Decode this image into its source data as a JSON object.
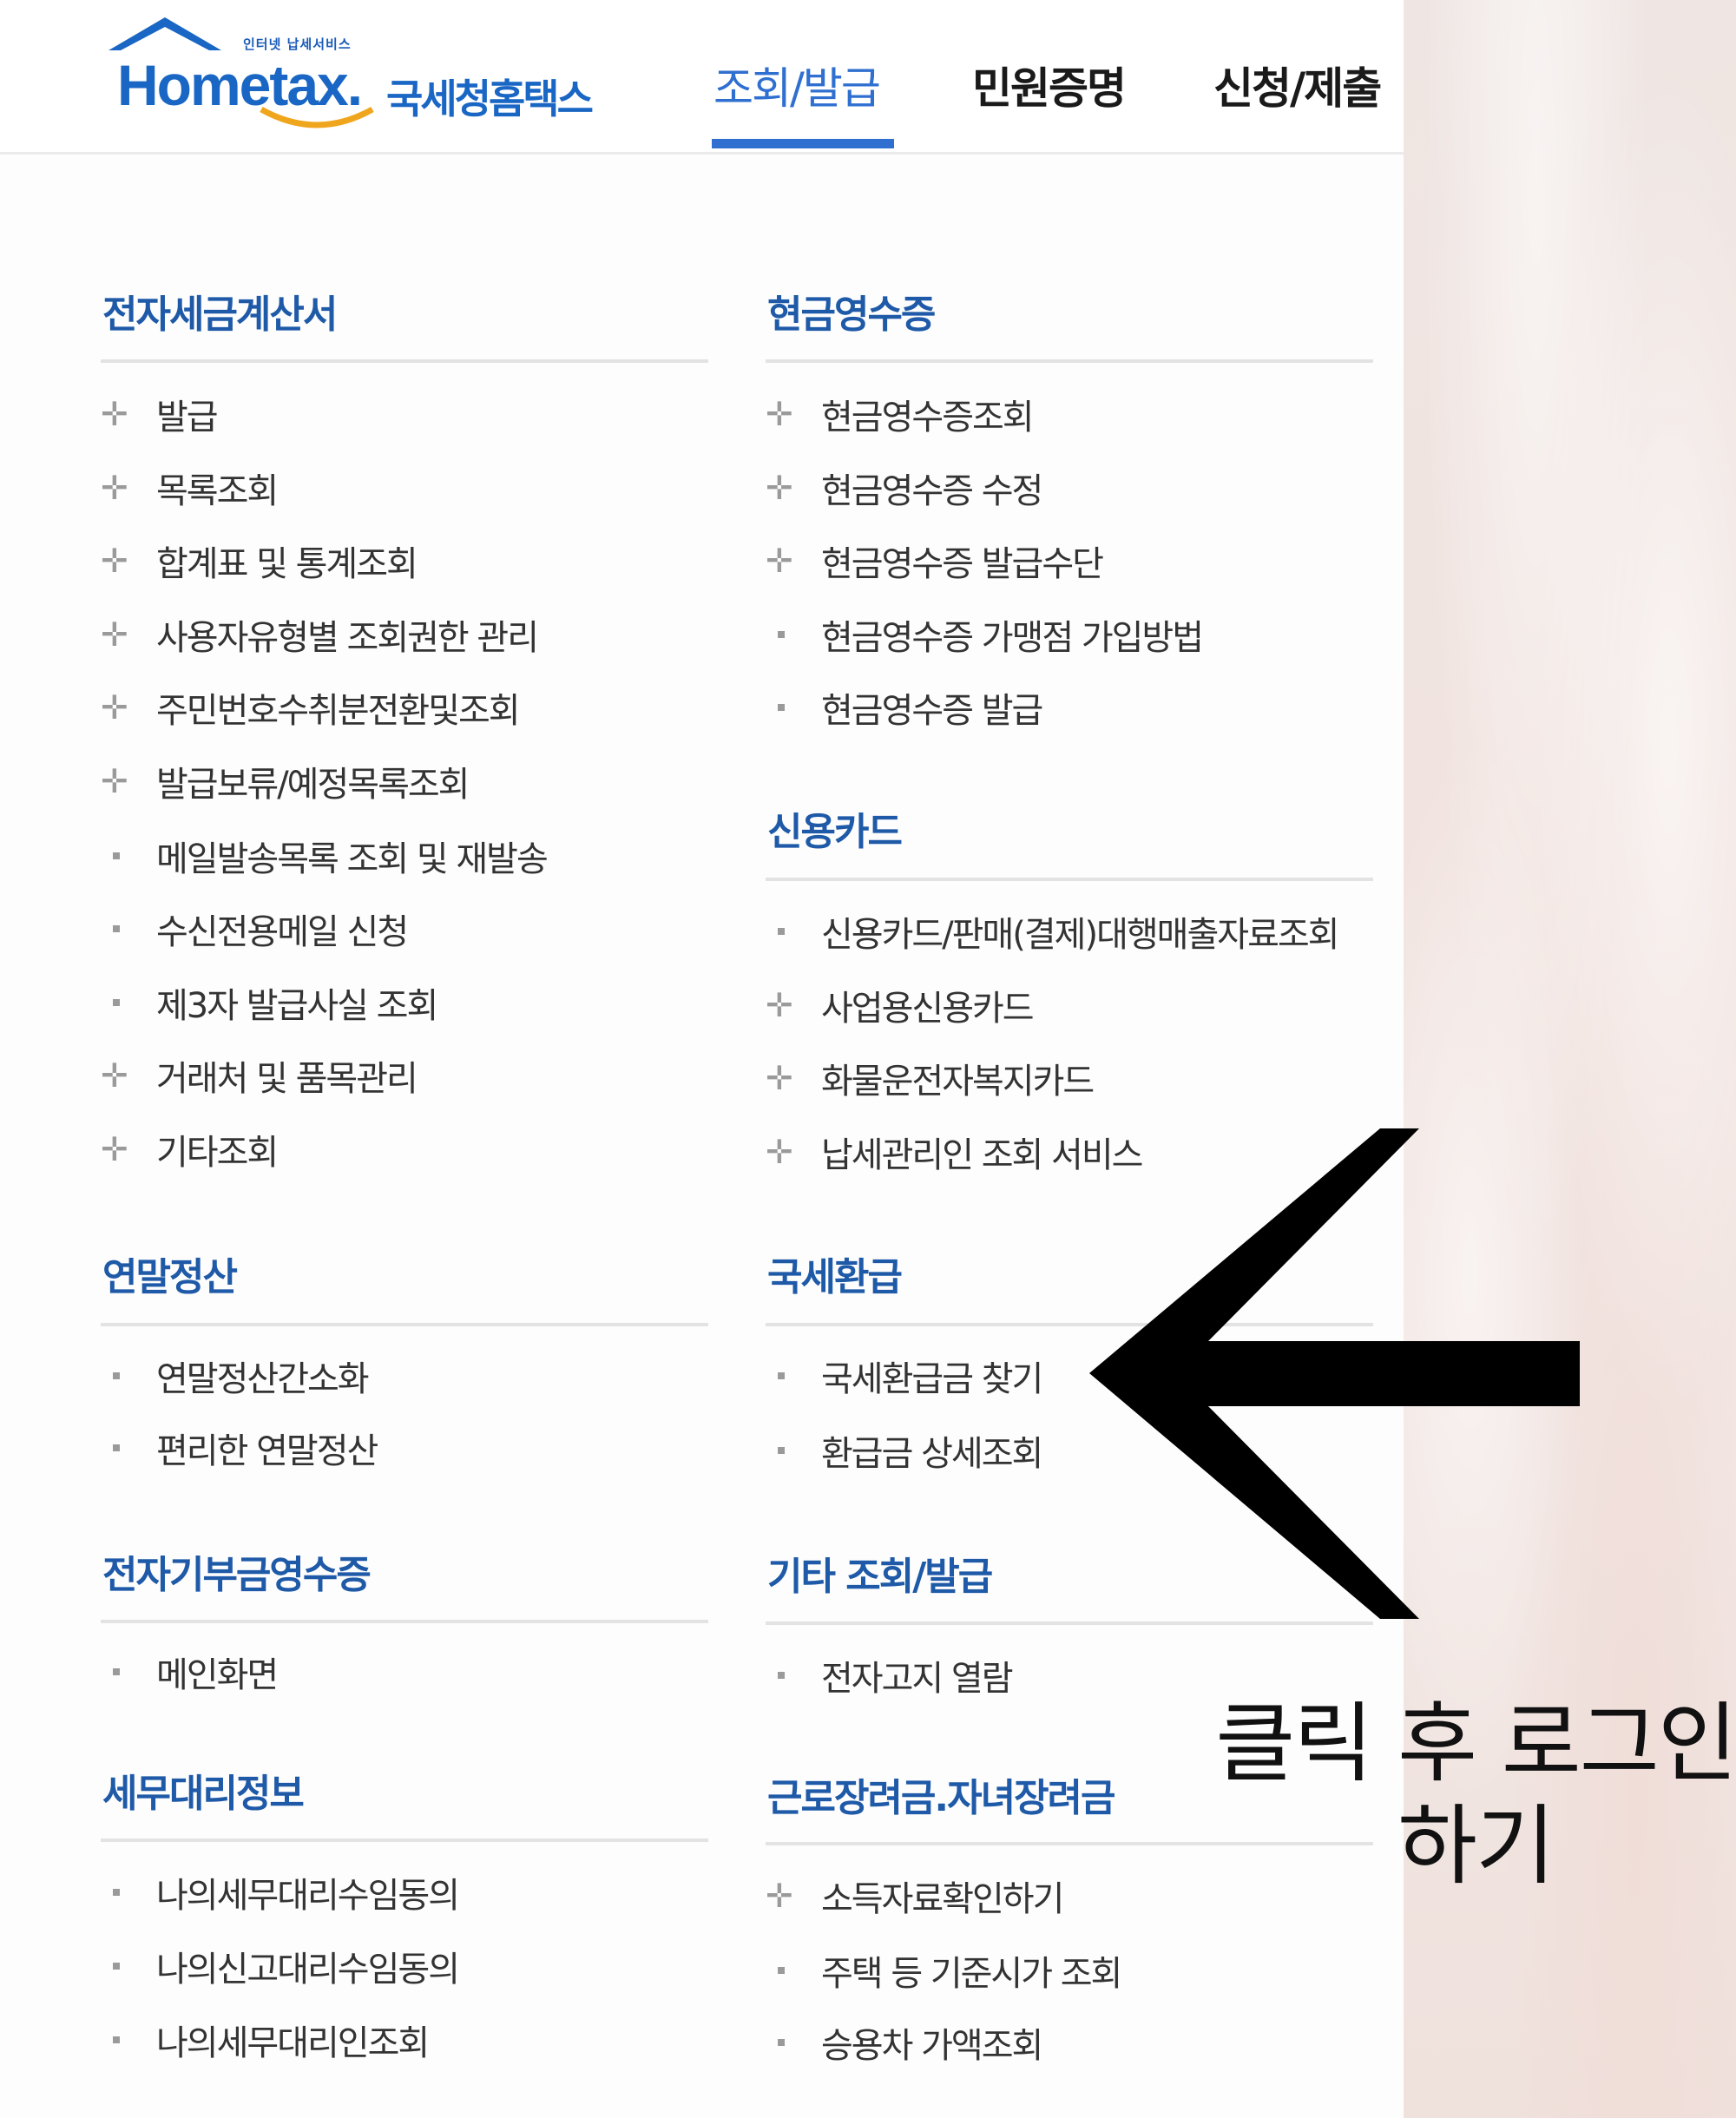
{
  "header": {
    "logo": {
      "small_text": "인터넷 납세서비스",
      "brand_text": "Hometax.",
      "korean_text": "국세청홈택스"
    },
    "tabs": [
      {
        "label": "조회/발급",
        "active": true
      },
      {
        "label": "민원증명",
        "active": false
      },
      {
        "label": "신청/제출",
        "active": false
      }
    ]
  },
  "left_column": [
    {
      "title": "전자세금계산서",
      "items": [
        {
          "label": "발급",
          "marker": "plus"
        },
        {
          "label": "목록조회",
          "marker": "plus"
        },
        {
          "label": "합계표 및 통계조회",
          "marker": "plus"
        },
        {
          "label": "사용자유형별 조회권한 관리",
          "marker": "plus"
        },
        {
          "label": "주민번호수취분전환및조회",
          "marker": "plus"
        },
        {
          "label": "발급보류/예정목록조회",
          "marker": "plus"
        },
        {
          "label": "메일발송목록 조회 및 재발송",
          "marker": "dot"
        },
        {
          "label": "수신전용메일 신청",
          "marker": "dot"
        },
        {
          "label": "제3자 발급사실 조회",
          "marker": "dot"
        },
        {
          "label": "거래처 및 품목관리",
          "marker": "plus"
        },
        {
          "label": "기타조회",
          "marker": "plus"
        }
      ]
    },
    {
      "title": "연말정산",
      "items": [
        {
          "label": "연말정산간소화",
          "marker": "dot"
        },
        {
          "label": "편리한 연말정산",
          "marker": "dot"
        }
      ]
    },
    {
      "title": "전자기부금영수증",
      "items": [
        {
          "label": "메인화면",
          "marker": "dot"
        }
      ]
    },
    {
      "title": "세무대리정보",
      "items": [
        {
          "label": "나의세무대리수임동의",
          "marker": "dot"
        },
        {
          "label": "나의신고대리수임동의",
          "marker": "dot"
        },
        {
          "label": "나의세무대리인조회",
          "marker": "dot"
        }
      ]
    }
  ],
  "right_column": [
    {
      "title": "현금영수증",
      "items": [
        {
          "label": "현금영수증조회",
          "marker": "plus"
        },
        {
          "label": "현금영수증 수정",
          "marker": "plus"
        },
        {
          "label": "현금영수증 발급수단",
          "marker": "plus"
        },
        {
          "label": "현금영수증 가맹점 가입방법",
          "marker": "dot"
        },
        {
          "label": "현금영수증 발급",
          "marker": "dot"
        }
      ]
    },
    {
      "title": "신용카드",
      "items": [
        {
          "label": "신용카드/판매(결제)대행매출자료조회",
          "marker": "dot"
        },
        {
          "label": "사업용신용카드",
          "marker": "plus"
        },
        {
          "label": "화물운전자복지카드",
          "marker": "plus"
        },
        {
          "label": "납세관리인 조회 서비스",
          "marker": "plus"
        }
      ]
    },
    {
      "title": "국세환급",
      "items": [
        {
          "label": "국세환급금 찾기",
          "marker": "dot"
        },
        {
          "label": "환급금 상세조회",
          "marker": "dot"
        }
      ]
    },
    {
      "title": "기타 조회/발급",
      "items": [
        {
          "label": "전자고지 열람",
          "marker": "dot"
        }
      ]
    },
    {
      "title": "근로장려금.자녀장려금",
      "items": [
        {
          "label": "소득자료확인하기",
          "marker": "plus"
        },
        {
          "label": "주택 등 기준시가 조회",
          "marker": "dot"
        },
        {
          "label": "승용차 가액조회",
          "marker": "dot"
        }
      ]
    }
  ],
  "annotation": {
    "icon": "left-arrow-icon",
    "caption_line1": "클릭 후 로그인",
    "caption_line2": "하기"
  },
  "colors": {
    "brand_blue": "#1966c4",
    "section_title": "#1f5aa8",
    "active_tab": "#2f6fd0",
    "marker_gray": "#9a9a9a"
  }
}
